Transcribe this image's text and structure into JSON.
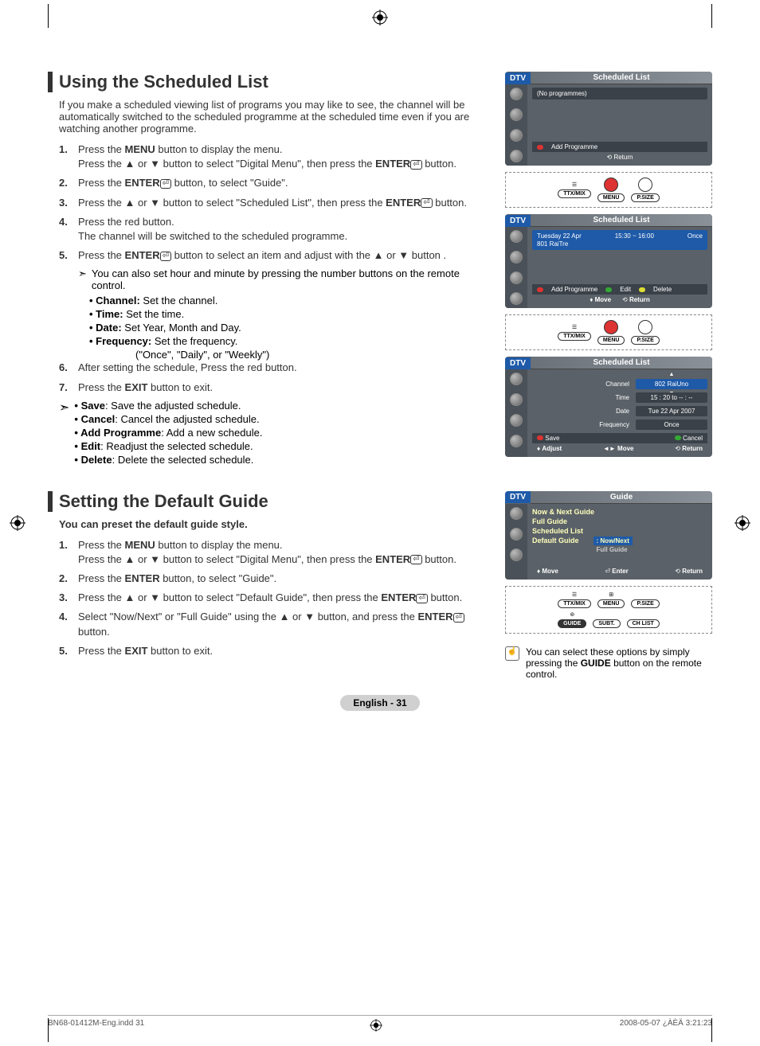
{
  "section1": {
    "title": "Using the Scheduled List",
    "intro": "If you make a scheduled viewing list of programs you may like to see, the channel will be automatically switched to the scheduled programme at the scheduled time even if you are watching another programme.",
    "steps": [
      {
        "n": "1.",
        "html": "Press the <b>MENU</b> button to display the menu.<br>Press the ▲ or ▼ button to select \"Digital Menu\", then press the <b>ENTER</b><span class='enter-icon'>⏎</span> button."
      },
      {
        "n": "2.",
        "html": "Press the <b>ENTER</b><span class='enter-icon'>⏎</span> button, to select \"Guide\"."
      },
      {
        "n": "3.",
        "html": "Press the ▲ or ▼ button to select \"Scheduled List\", then press the <b>ENTER</b><span class='enter-icon'>⏎</span> button."
      },
      {
        "n": "4.",
        "html": "Press the red button.<br>The channel will be switched to the scheduled programme."
      },
      {
        "n": "5.",
        "html": "Press the <b>ENTER</b><span class='enter-icon'>⏎</span> button to select an item and adjust with the ▲ or ▼ button ."
      }
    ],
    "note5": "You can also set hour and minute by pressing the number buttons on the remote control.",
    "bullets5": [
      {
        "b": "Channel:",
        "t": " Set the channel."
      },
      {
        "b": "Time:",
        "t": " Set the time."
      },
      {
        "b": "Date:",
        "t": " Set Year, Month and Day."
      },
      {
        "b": "Frequency:",
        "t": " Set the frequency."
      }
    ],
    "freq_note": "(\"Once\", \"Daily\", or \"Weekly\")",
    "steps_b": [
      {
        "n": "6.",
        "html": "After setting the schedule, Press the red button."
      },
      {
        "n": "7.",
        "html": "Press the <b>EXIT</b> button to exit."
      }
    ],
    "addl": [
      {
        "b": "Save",
        "t": ": Save the adjusted schedule."
      },
      {
        "b": "Cancel",
        "t": ": Cancel the adjusted schedule."
      },
      {
        "b": "Add Programme",
        "t": ": Add a new schedule."
      },
      {
        "b": "Edit",
        "t": ": Readjust the selected schedule."
      },
      {
        "b": "Delete",
        "t": ": Delete the selected schedule."
      }
    ]
  },
  "section2": {
    "title": "Setting the Default Guide",
    "intro": "You can preset the default guide style.",
    "steps": [
      {
        "n": "1.",
        "html": "Press the <b>MENU</b> button to display the menu.<br>Press the ▲ or ▼ button to select \"Digital Menu\", then press the <b>ENTER</b><span class='enter-icon'>⏎</span> button."
      },
      {
        "n": "2.",
        "html": "Press the <b>ENTER</b> button, to select \"Guide\"."
      },
      {
        "n": "3.",
        "html": "Press the ▲ or ▼ button to select \"Default Guide\", then press the <b>ENTER</b><span class='enter-icon'>⏎</span> button."
      },
      {
        "n": "4.",
        "html": "Select \"Now/Next\" or \"Full Guide\" using the ▲ or ▼ button, and press the <b>ENTER</b><span class='enter-icon'>⏎</span> button."
      },
      {
        "n": "5.",
        "html": "Press the <b>EXIT</b> button to exit."
      }
    ],
    "side_note": "You can select these options by simply pressing the <b>GUIDE</b> button on the remote control."
  },
  "dtv": {
    "tag": "DTV",
    "panel1": {
      "title": "Scheduled List",
      "empty": "(No programmes)",
      "add": "Add Programme",
      "return": "Return"
    },
    "panel2": {
      "title": "Scheduled List",
      "date": "Tuesday  22  Apr",
      "time": "15:30 ~ 16:00",
      "freq": "Once",
      "ch": "801  RaiTre",
      "add": "Add Programme",
      "edit": "Edit",
      "delete": "Delete",
      "move": "Move",
      "return": "Return"
    },
    "panel3": {
      "title": "Scheduled List",
      "channel_lbl": "Channel",
      "channel_val": "802 RaiUno",
      "time_lbl": "Time",
      "time_val": "15 : 20 to -- : --",
      "date_lbl": "Date",
      "date_val": "Tue 22 Apr 2007",
      "freq_lbl": "Frequency",
      "freq_val": "Once",
      "save": "Save",
      "cancel": "Cancel",
      "adjust": "Adjust",
      "move": "Move",
      "return": "Return"
    },
    "panel4": {
      "title": "Guide",
      "items": [
        "Now & Next Guide",
        "Full Guide",
        "Scheduled List",
        "Default Guide"
      ],
      "sel": "Now/Next",
      "alt": "Full Guide",
      "move": "Move",
      "enter": "Enter",
      "return": "Return"
    },
    "remote": {
      "ttx": "TTX/MIX",
      "menu": "MENU",
      "psize": "P.SIZE",
      "guide": "GUIDE",
      "subt": "SUBT.",
      "chlist": "CH LIST"
    }
  },
  "page_num": "English - 31",
  "footer": {
    "left": "BN68-01412M-Eng.indd   31",
    "right": "2008-05-07   ¿ÀÈÄ 3:21:23"
  }
}
